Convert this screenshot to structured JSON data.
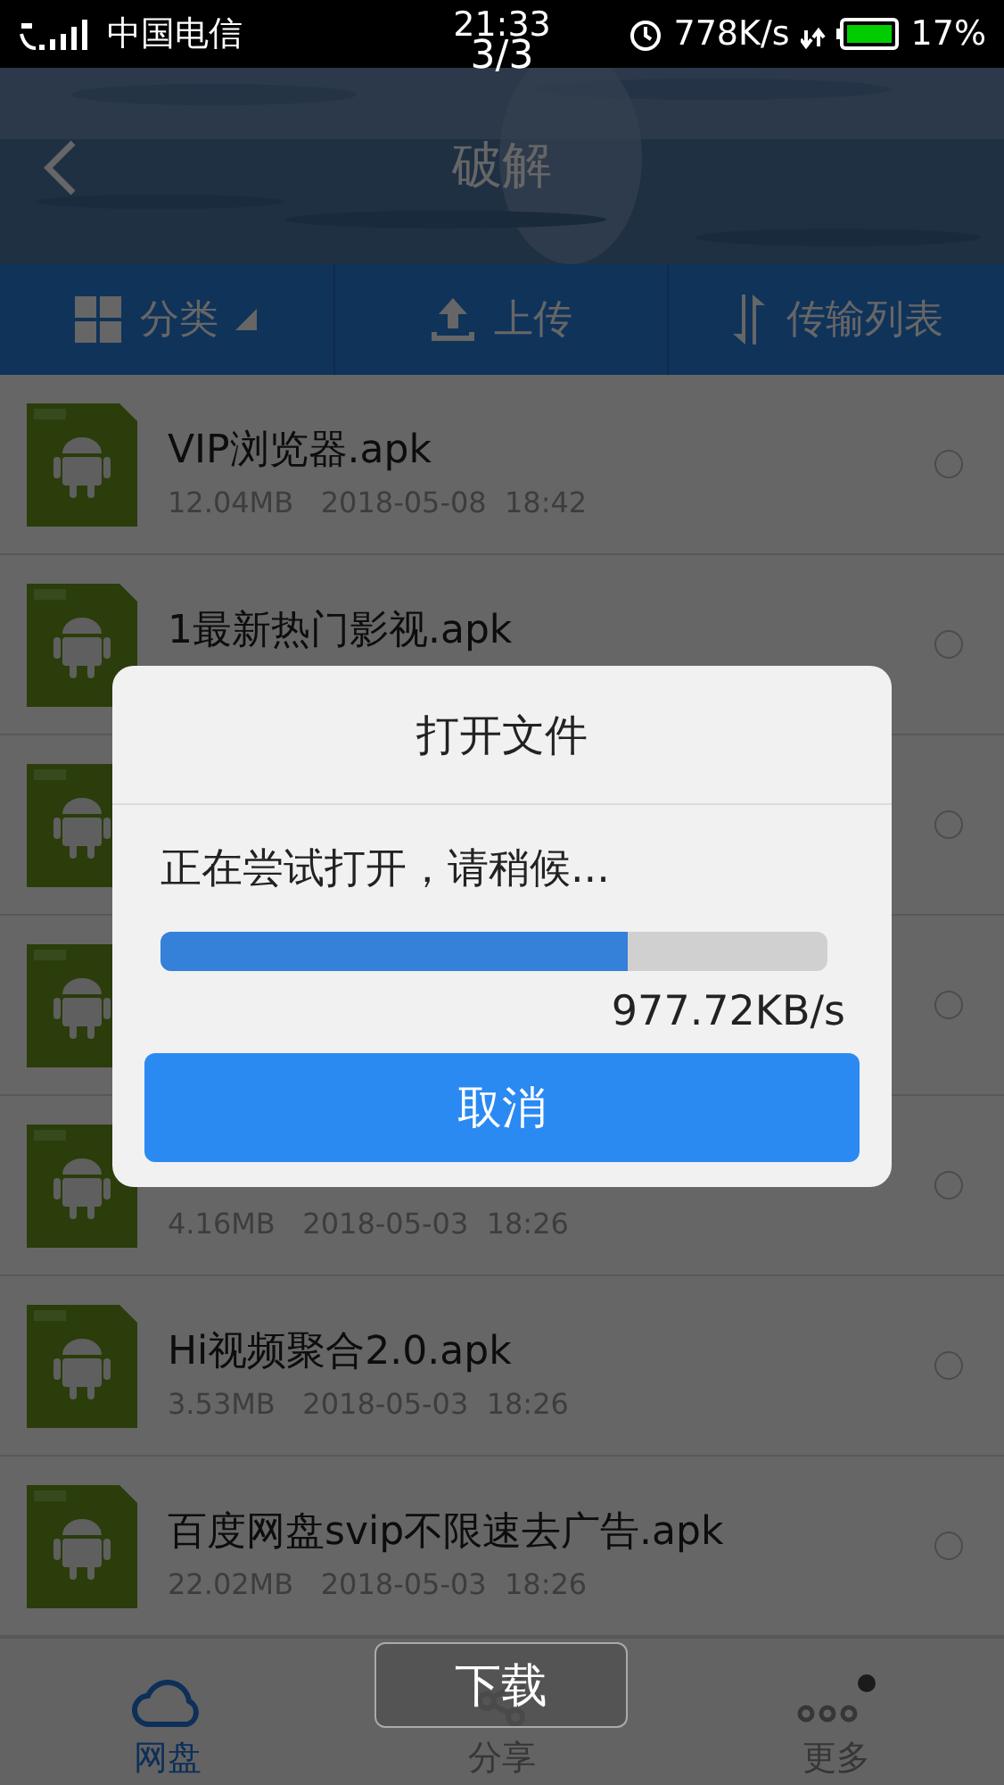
{
  "status_bar": {
    "carrier": "中国电信",
    "time": "21:33",
    "page_indicator": "3/3",
    "speed": "778K/s",
    "battery": "17%"
  },
  "header": {
    "title": "破解"
  },
  "toolbar": [
    {
      "kind": "category",
      "label": "分类"
    },
    {
      "kind": "upload",
      "label": "上传"
    },
    {
      "kind": "transfer",
      "label": "传输列表"
    }
  ],
  "files": [
    {
      "name": "VIP浏览器.apk",
      "size": "12.04MB",
      "date": "2018-05-08",
      "time": "18:42",
      "selected": false
    },
    {
      "name": "1最新热门影视.apk",
      "selected": false
    },
    {
      "selected": false
    },
    {
      "selected": false
    },
    {
      "size": "4.16MB",
      "date": "2018-05-03",
      "time": "18:26",
      "selected": false
    },
    {
      "name": "Hi视频聚合2.0.apk",
      "size": "3.53MB",
      "date": "2018-05-03",
      "time": "18:26",
      "selected": false
    },
    {
      "name": "百度网盘svip不限速去广告.apk",
      "size": "22.02MB",
      "date": "2018-05-03",
      "time": "18:26",
      "selected": false
    }
  ],
  "bottom_nav": [
    {
      "kind": "cloud",
      "label": "网盘",
      "selected": true
    },
    {
      "kind": "share",
      "label": "分享",
      "selected": false
    },
    {
      "kind": "more",
      "label": "更多",
      "selected": false
    }
  ],
  "dialog": {
    "title": "打开文件",
    "message": "正在尝试打开，请稍候...",
    "level": 0.7,
    "speed": "977.72KB/s",
    "button": "取消"
  },
  "toast": "下载"
}
